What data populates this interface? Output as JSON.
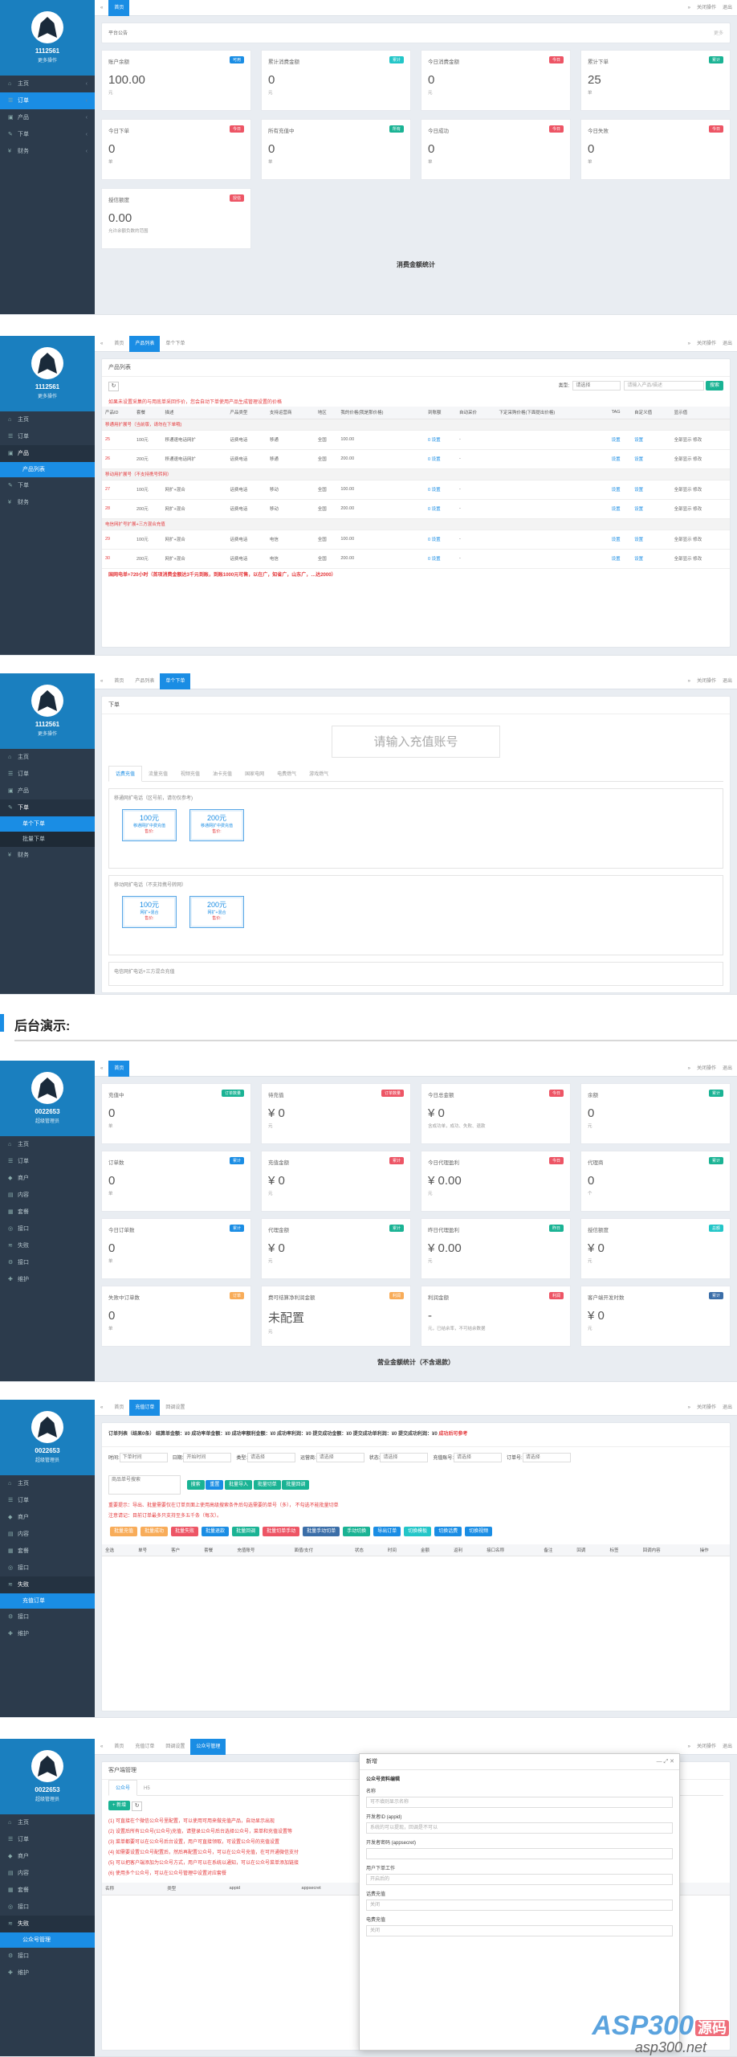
{
  "shot1": {
    "sidebar": {
      "user": "1112561",
      "role": "更多操作",
      "items": [
        {
          "icon": "⌂",
          "label": "主页"
        },
        {
          "icon": "☰",
          "label": "订单"
        },
        {
          "icon": "▣",
          "label": "产品"
        },
        {
          "icon": "✎",
          "label": "下单"
        },
        {
          "icon": "¥",
          "label": "财务"
        }
      ]
    },
    "tabs": [
      "首页"
    ],
    "right_tools": [
      "关闭操作",
      "退出"
    ],
    "notice": "平台公告",
    "notice_more": "更多",
    "stats": [
      {
        "t": "账户余额",
        "b": "可用",
        "v": "100.00",
        "u": "元",
        "c": "blue"
      },
      {
        "t": "累计消费金额",
        "b": "累计",
        "v": "0",
        "u": "元",
        "c": "cyan"
      },
      {
        "t": "今日消费金额",
        "b": "今日",
        "v": "0",
        "u": "元",
        "c": "red"
      },
      {
        "t": "累计下单",
        "b": "累计",
        "v": "25",
        "u": "单",
        "c": "green"
      },
      {
        "t": "今日下单",
        "b": "今日",
        "v": "0",
        "u": "单",
        "c": "red"
      },
      {
        "t": "所有充值中",
        "b": "所有",
        "v": "0",
        "u": "单",
        "c": "green"
      },
      {
        "t": "今日成功",
        "b": "今日",
        "v": "0",
        "u": "单",
        "c": "red"
      },
      {
        "t": "今日失败",
        "b": "今日",
        "v": "0",
        "u": "单",
        "c": "red"
      },
      {
        "t": "授信额度",
        "b": "授信",
        "v": "0.00",
        "u": "允许余额负数的范围",
        "c": "red"
      }
    ],
    "footer": "消费金额统计"
  },
  "shot2": {
    "tabs": [
      "首页",
      "产品列表",
      "单个下单"
    ],
    "title": "产品列表",
    "filter_label": "类型:",
    "filter_value": "请选择",
    "search_ph": "请输入产品/描述",
    "search_btn": "搜索",
    "warn": "如果未设置采集的与用底单采回作价，您会自动下单使用产品生成管理设置的价格",
    "headers": [
      "产品ID",
      "套餐",
      "描述",
      "产品类型",
      "支持运营商",
      "地区",
      "我的价格(我是那价格)",
      "到账额",
      "自动采价",
      "下定采购价格(下面提出价格)",
      "TAG",
      "自定义值",
      "显示值"
    ],
    "groups": [
      {
        "name": "移通用扩展号（当前版，请勿在下单哦)",
        "rows": [
          [
            "25",
            "100元",
            "移通速电话网扩",
            "话费电话",
            "移通",
            "全国",
            "100.00",
            "0 设置",
            "-"
          ],
          [
            "26",
            "200元",
            "移通速电话网扩",
            "话费电话",
            "移通",
            "全国",
            "200.00",
            "0 设置",
            "-"
          ]
        ]
      },
      {
        "name": "移动用扩展号（不支持携号转网）",
        "rows": [
          [
            "27",
            "100元",
            "网扩+混合",
            "话费电话",
            "移动",
            "全国",
            "100.00",
            "0 设置",
            "-"
          ],
          [
            "28",
            "200元",
            "网扩+混合",
            "话费电话",
            "移动",
            "全国",
            "200.00",
            "0 设置",
            "-"
          ]
        ]
      },
      {
        "name": "电信网扩号扩展+三方混合充值",
        "rows": [
          [
            "29",
            "100元",
            "网扩+混合",
            "话费电话",
            "电信",
            "全国",
            "100.00",
            "0 设置",
            "-"
          ],
          [
            "30",
            "200元",
            "网扩+混合",
            "话费电话",
            "电信",
            "全国",
            "200.00",
            "0 设置",
            "-"
          ]
        ]
      }
    ],
    "row_link": "设置",
    "row_show": "全部显示 修改",
    "bottom_warn": "国网电单+720小时（首项消费金额达3千元到账，到账1000元可售，以在广，知省广，山东广，…达2000）"
  },
  "shot3": {
    "tabs": [
      "首页",
      "产品列表",
      "单个下单"
    ],
    "title": "下单",
    "input_ph": "请输入充值账号",
    "otabs": [
      "话费充值",
      "流量充值",
      "视频充值",
      "油卡充值",
      "国家电网",
      "电费燃气",
      "游戏燃气"
    ],
    "boxes": [
      {
        "h": "移通网扩电话（区号前，请勿仅参考)",
        "items": [
          {
            "v": "100元",
            "s": "移通网扩中费充值",
            "p": "售价:"
          },
          {
            "v": "200元",
            "s": "移通网扩中费充值",
            "p": "售价:"
          }
        ]
      },
      {
        "h": "移动网扩电话（不支持携号转网）",
        "items": [
          {
            "v": "100元",
            "s": "网扩+混合",
            "p": "售价:"
          },
          {
            "v": "200元",
            "s": "网扩+混合",
            "p": "售价:"
          }
        ]
      }
    ],
    "box3": "电信网扩电话+三方混合充值"
  },
  "section_title": "后台演示:",
  "shot4": {
    "sidebar": {
      "user": "0022653",
      "role": "超级管理员",
      "items": [
        {
          "icon": "⌂",
          "label": "主页"
        },
        {
          "icon": "☰",
          "label": "订单"
        },
        {
          "icon": "◆",
          "label": "商户"
        },
        {
          "icon": "▤",
          "label": "内容"
        },
        {
          "icon": "▦",
          "label": "套餐"
        },
        {
          "icon": "◎",
          "label": "接口"
        },
        {
          "icon": "≋",
          "label": "失败"
        },
        {
          "icon": "⚙",
          "label": "接口"
        },
        {
          "icon": "✚",
          "label": "维护"
        }
      ]
    },
    "stats": [
      {
        "t": "充值中",
        "b": "订单数量",
        "v": "0",
        "u": "单",
        "c": "green"
      },
      {
        "t": "待充值",
        "b": "订单数量",
        "v": "¥ 0",
        "u": "元",
        "c": "red"
      },
      {
        "t": "今日总金额",
        "b": "今日",
        "v": "¥ 0",
        "u": "含成功单，成功、失败、退款",
        "c": "red"
      },
      {
        "t": "余额",
        "b": "累计",
        "v": "0",
        "u": "元",
        "c": "green"
      },
      {
        "t": "订单数",
        "b": "累计",
        "v": "0",
        "u": "单",
        "c": "blue"
      },
      {
        "t": "充值金额",
        "b": "累计",
        "v": "¥ 0",
        "u": "元",
        "c": "red"
      },
      {
        "t": "今日代理盈利",
        "b": "今日",
        "v": "¥ 0.00",
        "u": "元",
        "c": "red"
      },
      {
        "t": "代理商",
        "b": "累计",
        "v": "0",
        "u": "个",
        "c": "green"
      },
      {
        "t": "今日订单数",
        "b": "累计",
        "v": "0",
        "u": "单",
        "c": "blue"
      },
      {
        "t": "代理金额",
        "b": "累计",
        "v": "¥ 0",
        "u": "元",
        "c": "green"
      },
      {
        "t": "昨日代理盈利",
        "b": "昨日",
        "v": "¥ 0.00",
        "u": "元",
        "c": "green"
      },
      {
        "t": "授信额度",
        "b": "总额",
        "v": "¥ 0",
        "u": "元",
        "c": "cyan"
      },
      {
        "t": "失败中订单数",
        "b": "订单",
        "v": "0",
        "u": "单",
        "c": "orange"
      },
      {
        "t": "费可结算净利润金额",
        "b": "利润",
        "v": "未配置",
        "u": "元",
        "c": "orange"
      },
      {
        "t": "利润金额",
        "b": "利润",
        "v": "-",
        "u": "元，已结余率，不可结余数据",
        "c": "red"
      },
      {
        "t": "客户端开发时数",
        "b": "累计",
        "v": "¥ 0",
        "u": "元",
        "c": "navy"
      }
    ],
    "footer": "营业金额统计（不含退款）"
  },
  "shot5": {
    "tabs": [
      "首页",
      "充值订单",
      "回调设置"
    ],
    "summary": "订单列表（结果0条）  结算单金额：¥0  成功率单金额：¥0  成功率额利金额：¥0  成功率利润：¥0  提交成功金额：¥0  提交成功单利润：¥0  提交成功利润：¥0",
    "summary_red": "成功后可参考",
    "filters": [
      "时间:",
      "下单时间",
      "日期:",
      "开始时间",
      "类型:",
      "请选择",
      "运营商:",
      "请选择",
      "状态:",
      "请选择",
      "充值账号:",
      "请选择",
      "订单号:",
      "请选择"
    ],
    "ops": [
      "批量充值",
      "批量成功",
      "批量失败",
      "批量退款",
      "批量回调",
      "批量切单手动",
      "批量手动切单",
      "手动切换",
      "导出订单",
      "切换模板",
      "切换话费",
      "切换视频"
    ],
    "ops_colors": [
      "orange",
      "orange",
      "red",
      "blue",
      "green",
      "red",
      "navy",
      "green",
      "blue",
      "cyan",
      "blue",
      "blue"
    ],
    "search_btns": [
      "搜索",
      "重置",
      "批量导入",
      "批量切单",
      "批量回调"
    ],
    "warn1": "重要提示：导出、批量需要仅在订单页面上使用高级搜索条件后勾选需要的单号（多）， 不勾选不能批量切单",
    "warn2": "注意请记：目前订单最多只支持至多五千条（每次）。",
    "headers": [
      "全选",
      "单号",
      "客户",
      "套餐",
      "充值账号",
      "面值/支付",
      "状态",
      "时间",
      "金额",
      "返利",
      "接口名称",
      "备注",
      "回调",
      "标签",
      "回调内容",
      "操作"
    ]
  },
  "shot6": {
    "tabs": [
      "首页",
      "充值订单",
      "回调设置",
      "公众号管理"
    ],
    "title": "客户端管理",
    "subtabs": [
      "公众号",
      "H5"
    ],
    "add_btn": "+ 新增",
    "notes": [
      "(1) 可直接在个微信公众号里配置，可以使用可用来做充值产品，自动显示出现",
      "(2) 设置后所有公众号(公众号)充值，请登录公众号后台选择公众号，菜单和充值设置等",
      "(3) 菜单都要可以在公众号后台设置，用户可直接领取，可设置公众号的充值设置",
      "(4) 如需要设置公众号配置后，然后再配置公众号，可以在公众号充值，在可开通微信支付",
      "(5) 可以把客户端添加为公众号方式，用户可以在系统以通知，可以在公众号菜单添加链接",
      "(6) 使用多个公众号，可以在公众号管理中设置对应套餐"
    ],
    "headers": [
      "名称",
      "类型",
      "appid",
      "appsecret",
      "token",
      "encodingaeskey",
      "操作"
    ],
    "modal": {
      "title": "新增",
      "section": "公众号资料编辑",
      "fields": [
        {
          "l": "名称",
          "ph": "可不填则显示名称"
        },
        {
          "l": "开发者ID (appid)",
          "ph": "系统的可以提现，回调是不可以"
        },
        {
          "l": "开发者密码 (appsecret)",
          "ph": ""
        },
        {
          "l": "用户下单工作",
          "ph": "开启后的"
        },
        {
          "l": "话费充值",
          "ph": "关闭"
        },
        {
          "l": "电费充值",
          "ph": "关闭"
        }
      ]
    },
    "watermark": "ASP300",
    "watermark_tag": "源码",
    "watermark2": "asp300.net"
  }
}
